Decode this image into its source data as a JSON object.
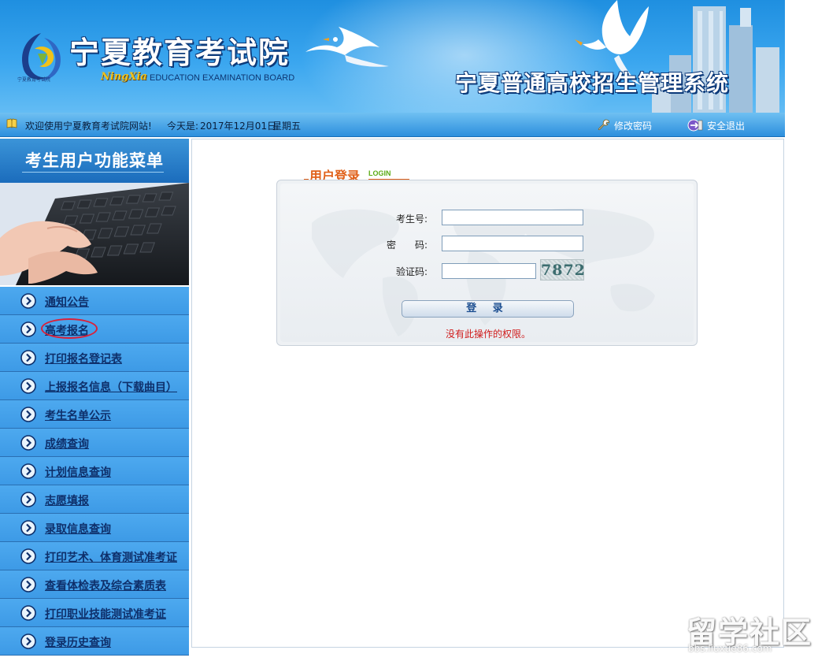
{
  "header": {
    "logo_small_text": "宁夏教育考试院",
    "org_name": "宁夏教育考试院",
    "ningxia_script": "NingXia",
    "org_name_en": "EDUCATION EXAMINATION BOARD",
    "system_name": "宁夏普通高校招生管理系统"
  },
  "infobar": {
    "welcome": "欢迎使用宁夏教育考试院网站!",
    "date_label": "今天是:",
    "date_value": "2017年12月01日",
    "weekday": "星期五",
    "change_password": "修改密码",
    "logout": "安全退出"
  },
  "sidebar": {
    "title": "考生用户功能菜单",
    "items": [
      {
        "label": "通知公告"
      },
      {
        "label": "高考报名"
      },
      {
        "label": "打印报名登记表"
      },
      {
        "label": "上报报名信息（下载曲目）"
      },
      {
        "label": "考生名单公示"
      },
      {
        "label": "成绩查询"
      },
      {
        "label": "计划信息查询"
      },
      {
        "label": "志愿填报"
      },
      {
        "label": "录取信息查询"
      },
      {
        "label": "打印艺术、体育测试准考证"
      },
      {
        "label": "查看体检表及综合素质表"
      },
      {
        "label": "打印职业技能测试准考证"
      },
      {
        "label": "登录历史查询"
      }
    ]
  },
  "login": {
    "section_title": "用户登录",
    "section_sub": "LOGIN",
    "fields": {
      "exam_no_label": "考生号:",
      "exam_no_value": "",
      "password_label": "密　　码:",
      "password_value": "",
      "captcha_label": "验证码:",
      "captcha_value": ""
    },
    "captcha_code": "7872",
    "submit_label": "登 录",
    "error_message": "没有此操作的权限。"
  },
  "watermark": {
    "big": "留学社区",
    "small": "bbs.liuxue86.com"
  },
  "colors": {
    "banner_blue": "#2b9ae8",
    "menu_blue": "#4da9ef",
    "menu_text": "#0e2f6a",
    "title_orange": "#e0611a",
    "login_green": "#5bab14",
    "error_red": "#d01b1b",
    "highlight_ring": "#d9213a"
  },
  "icons": {
    "welcome": "book-icon",
    "change_password": "wrench-icon",
    "logout": "exit-icon",
    "menu_item": "circle-arrow-right-icon"
  }
}
